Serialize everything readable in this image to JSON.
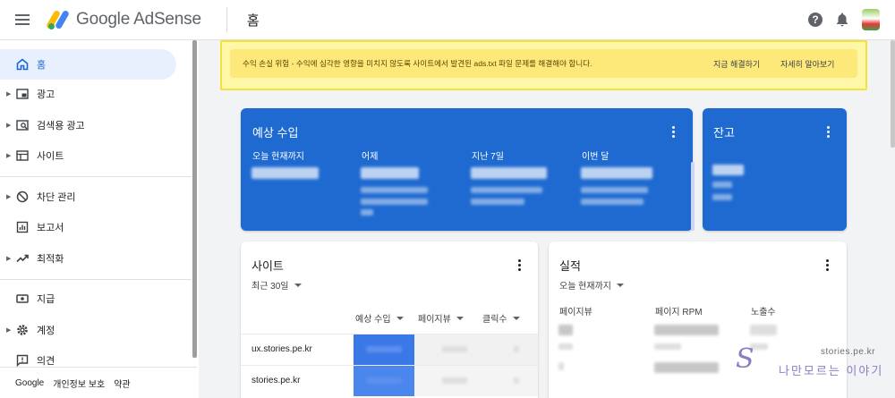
{
  "app": {
    "logo_text": "Google AdSense",
    "page_title": "홈"
  },
  "sidebar": {
    "items": [
      {
        "label": "홈",
        "icon": "home-icon",
        "active": true
      },
      {
        "label": "광고",
        "icon": "ad-unit-icon"
      },
      {
        "label": "검색용 광고",
        "icon": "search-ads-icon"
      },
      {
        "label": "사이트",
        "icon": "sites-icon"
      },
      {
        "label": "차단 관리",
        "icon": "block-icon"
      },
      {
        "label": "보고서",
        "icon": "report-icon"
      },
      {
        "label": "최적화",
        "icon": "trending-up-icon"
      },
      {
        "label": "지급",
        "icon": "payments-icon"
      },
      {
        "label": "계정",
        "icon": "gear-icon"
      },
      {
        "label": "의견",
        "icon": "feedback-icon"
      }
    ],
    "footer": {
      "brand": "Google",
      "privacy": "개인정보 보호",
      "terms": "약관"
    }
  },
  "alert": {
    "text": "수익 손실 위험 - 수익에 심각한 영향을 미치지 않도록 사이트에서 발견된 ads.txt 파일 문제를 해결해야 합니다.",
    "fix_now": "지금 해결하기",
    "learn_more": "자세히 알아보기"
  },
  "earnings_card": {
    "title": "예상 수입",
    "metrics": [
      {
        "label": "오늘 현재까지"
      },
      {
        "label": "어제"
      },
      {
        "label": "지난 7일"
      },
      {
        "label": "이번 달"
      }
    ]
  },
  "balance_card": {
    "title": "잔고"
  },
  "sites_card": {
    "title": "사이트",
    "range": "최근 30일",
    "columns": [
      "예상 수입",
      "페이지뷰",
      "클릭수"
    ],
    "rows": [
      {
        "site": "ux.stories.pe.kr"
      },
      {
        "site": "stories.pe.kr"
      }
    ]
  },
  "performance_card": {
    "title": "실적",
    "range": "오늘 현재까지",
    "columns": [
      "페이지뷰",
      "페이지 RPM",
      "노출수"
    ]
  },
  "watermark": {
    "url": "stories.pe.kr",
    "text": "나만모르는 이야기",
    "logo_letter": "S"
  },
  "colors": {
    "accent": "#1f6ad1",
    "alert_bg": "#fde97a",
    "alert_border": "#f3e23a"
  }
}
